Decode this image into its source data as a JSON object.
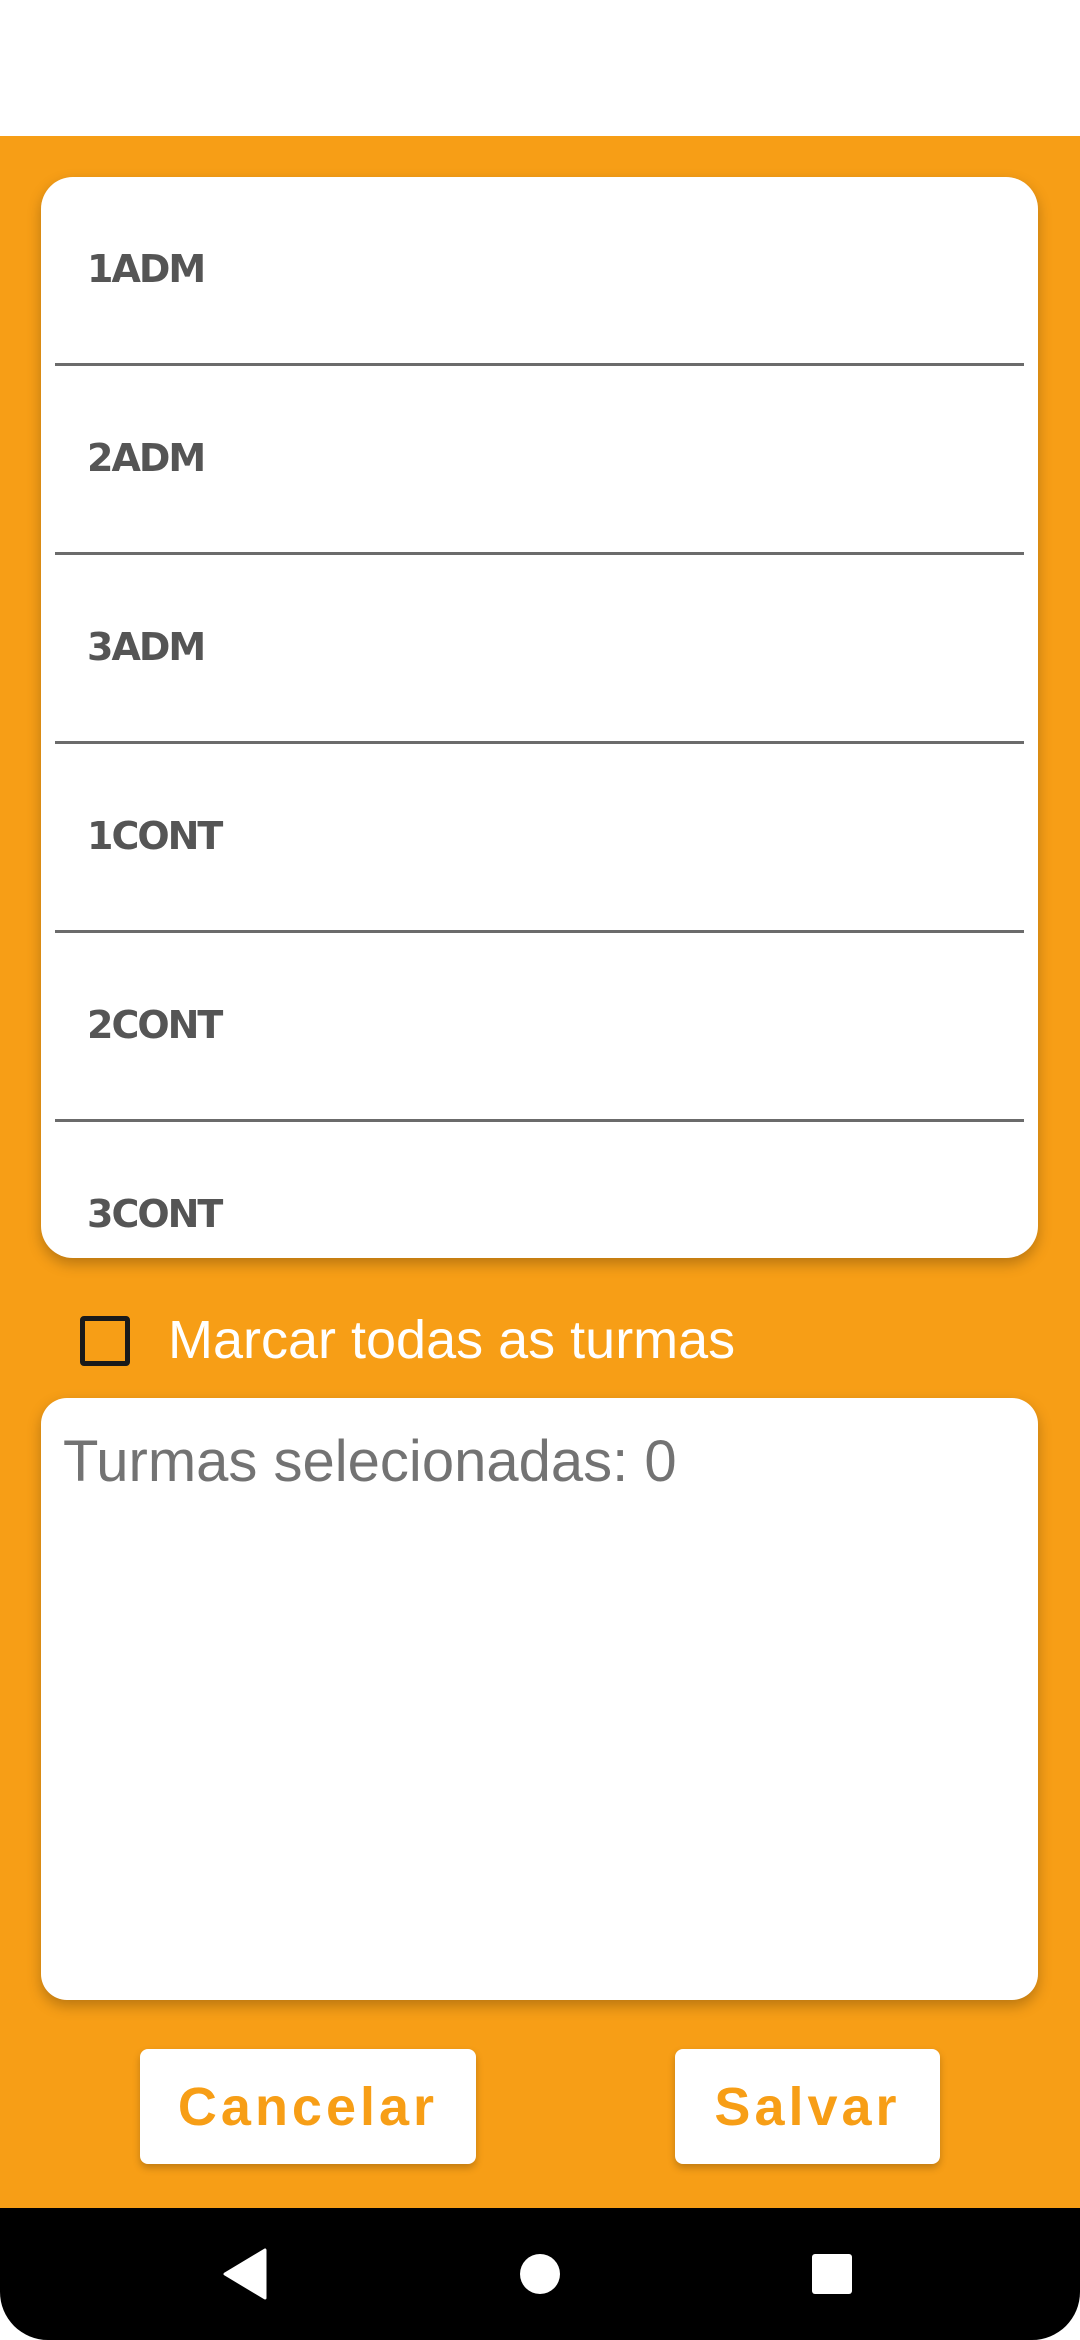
{
  "colors": {
    "accent": "#F79E16",
    "card": "#FFFFFF",
    "item_text": "#555555",
    "divider": "#6B6B6B"
  },
  "class_list": {
    "items": [
      {
        "label": "1ADM"
      },
      {
        "label": "2ADM"
      },
      {
        "label": "3ADM"
      },
      {
        "label": "1CONT"
      },
      {
        "label": "2CONT"
      },
      {
        "label": "3CONT"
      }
    ]
  },
  "select_all": {
    "label": "Marcar todas as turmas",
    "checked": false
  },
  "selected_summary": {
    "text": "Turmas selecionadas: 0"
  },
  "actions": {
    "cancel_label": "Cancelar",
    "save_label": "Salvar"
  },
  "navbar": {
    "icons": [
      "back-icon",
      "home-icon",
      "recents-icon"
    ]
  }
}
